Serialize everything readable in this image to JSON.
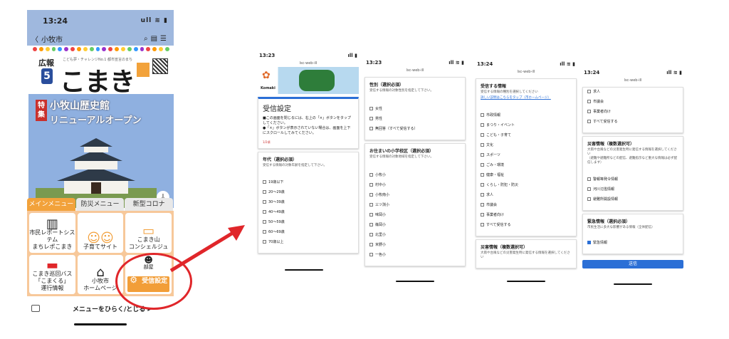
{
  "phone1": {
    "time": "13:24",
    "status_icons": "ull ≋ ▮",
    "nav_back": "〈",
    "nav_city": "小牧市",
    "nav_icons": [
      "search-icon",
      "page-icon",
      "menu-icon"
    ],
    "cover": {
      "koho": "広報",
      "issue": "5",
      "tagline": "こども夢・チャレンジNo.1 都市宣言のまち",
      "title": "こまき",
      "special_tag": "特集",
      "special_title1": "小牧山歴史館",
      "special_title2": "リニューアルオープン"
    },
    "tabs": [
      "メインメニュー",
      "防災メニュー",
      "新型コロナ"
    ],
    "tiles": [
      {
        "label": "市民レポートシステム\nまちレポこまき",
        "icon": "road-icon",
        "glyph": "▥"
      },
      {
        "label": "子育てサイト",
        "icon": "children-icon",
        "glyph": "☺☺"
      },
      {
        "label": "こまき山\nコンシェルジュ",
        "icon": "chat-icon",
        "glyph": "▭"
      },
      {
        "label": "こまき巡回バス\n「こまくる」\n運行情報",
        "icon": "bus-icon",
        "glyph": "▬"
      },
      {
        "label": "小牧市\nホームページ",
        "icon": "home-icon",
        "glyph": "⌂"
      },
      {
        "label": "部屋",
        "icon": "person-icon",
        "glyph": "☻"
      }
    ],
    "settings_tile": "受信設定",
    "bottom_text": "メニューをひらく/とじる ▸"
  },
  "phone2": {
    "time": "13:23",
    "url": "lsc-web-ill",
    "logo_text": "Komaki",
    "setting_title": "受信設定",
    "setting_desc": "■この画面を閉じるには、右上の「×」ボタンをタップしてください。\n●「×」ボタンが表示されていない場合は、画面を上下にスクロールしてみてください。",
    "setting_small": "1/2項",
    "age_title": "年代（選択必須）",
    "age_desc": "受信する情報の対象年齢を指定して下さい。",
    "age_options": [
      "19歳以下",
      "20～29歳",
      "30～39歳",
      "40～49歳",
      "50～59歳",
      "60～69歳",
      "70歳以上"
    ]
  },
  "phone3": {
    "time": "13:23",
    "url": "lsc-web-ill",
    "gender_title": "性別（選択必須）",
    "gender_desc": "受信する情報の対象性別を指定して下さい。",
    "gender_options": [
      "女性",
      "男性",
      "無回答（すべて受信する）"
    ],
    "school_title": "お住まいの小学校区（選択必須）",
    "school_desc": "受信する情報の対象地域を指定して下さい。",
    "school_options": [
      "小牧小",
      "村中小",
      "小牧南小",
      "三ツ渕小",
      "味岡小",
      "篠岡小",
      "北里小",
      "米野小",
      "一色小"
    ]
  },
  "phone4": {
    "time": "13:24",
    "url": "lsc-web-ill",
    "info_title": "受信する情報",
    "info_desc": "受信する情報の種別を選択してください",
    "info_link": "詳しい説明はこちらをタップ（市ホームページ）",
    "info_options": [
      "市政情報",
      "まつり・イベント",
      "こども・子育て",
      "文化",
      "スポーツ",
      "ごみ・環境",
      "健康・福祉",
      "くらし・防犯・防災",
      "求人",
      "市議会",
      "事業者向け",
      "すべて受信する"
    ],
    "disaster_title": "災害情報（複数選択可）",
    "disaster_desc": "大雨や台風などの災害発生時に発信する情報を選択してください"
  },
  "phone5": {
    "time": "13:24",
    "url": "lsc-web-ill",
    "top_options": [
      "求人",
      "市議会",
      "事業者向け",
      "すべて受信する"
    ],
    "disaster_title": "災害情報（複数選択可）",
    "disaster_desc": "大雨や台風などの災害発生時に発信する情報を選択してください\n（避難や避難所などの配信、避難指示など重大な情報は必ず配信します）",
    "disaster_options": [
      "警報等発令情報",
      "河川氾濫情報",
      "避難所開設情報"
    ],
    "emergency_title": "緊急情報（選択必須）",
    "emergency_desc": "市民生活に多大な影響がある情報（全体配信）",
    "emergency_option": "緊急情報",
    "submit": "送信"
  },
  "colors": {
    "accent_orange": "#f29e38",
    "annotation_red": "#e0262a",
    "link_blue": "#2b6fd6"
  }
}
